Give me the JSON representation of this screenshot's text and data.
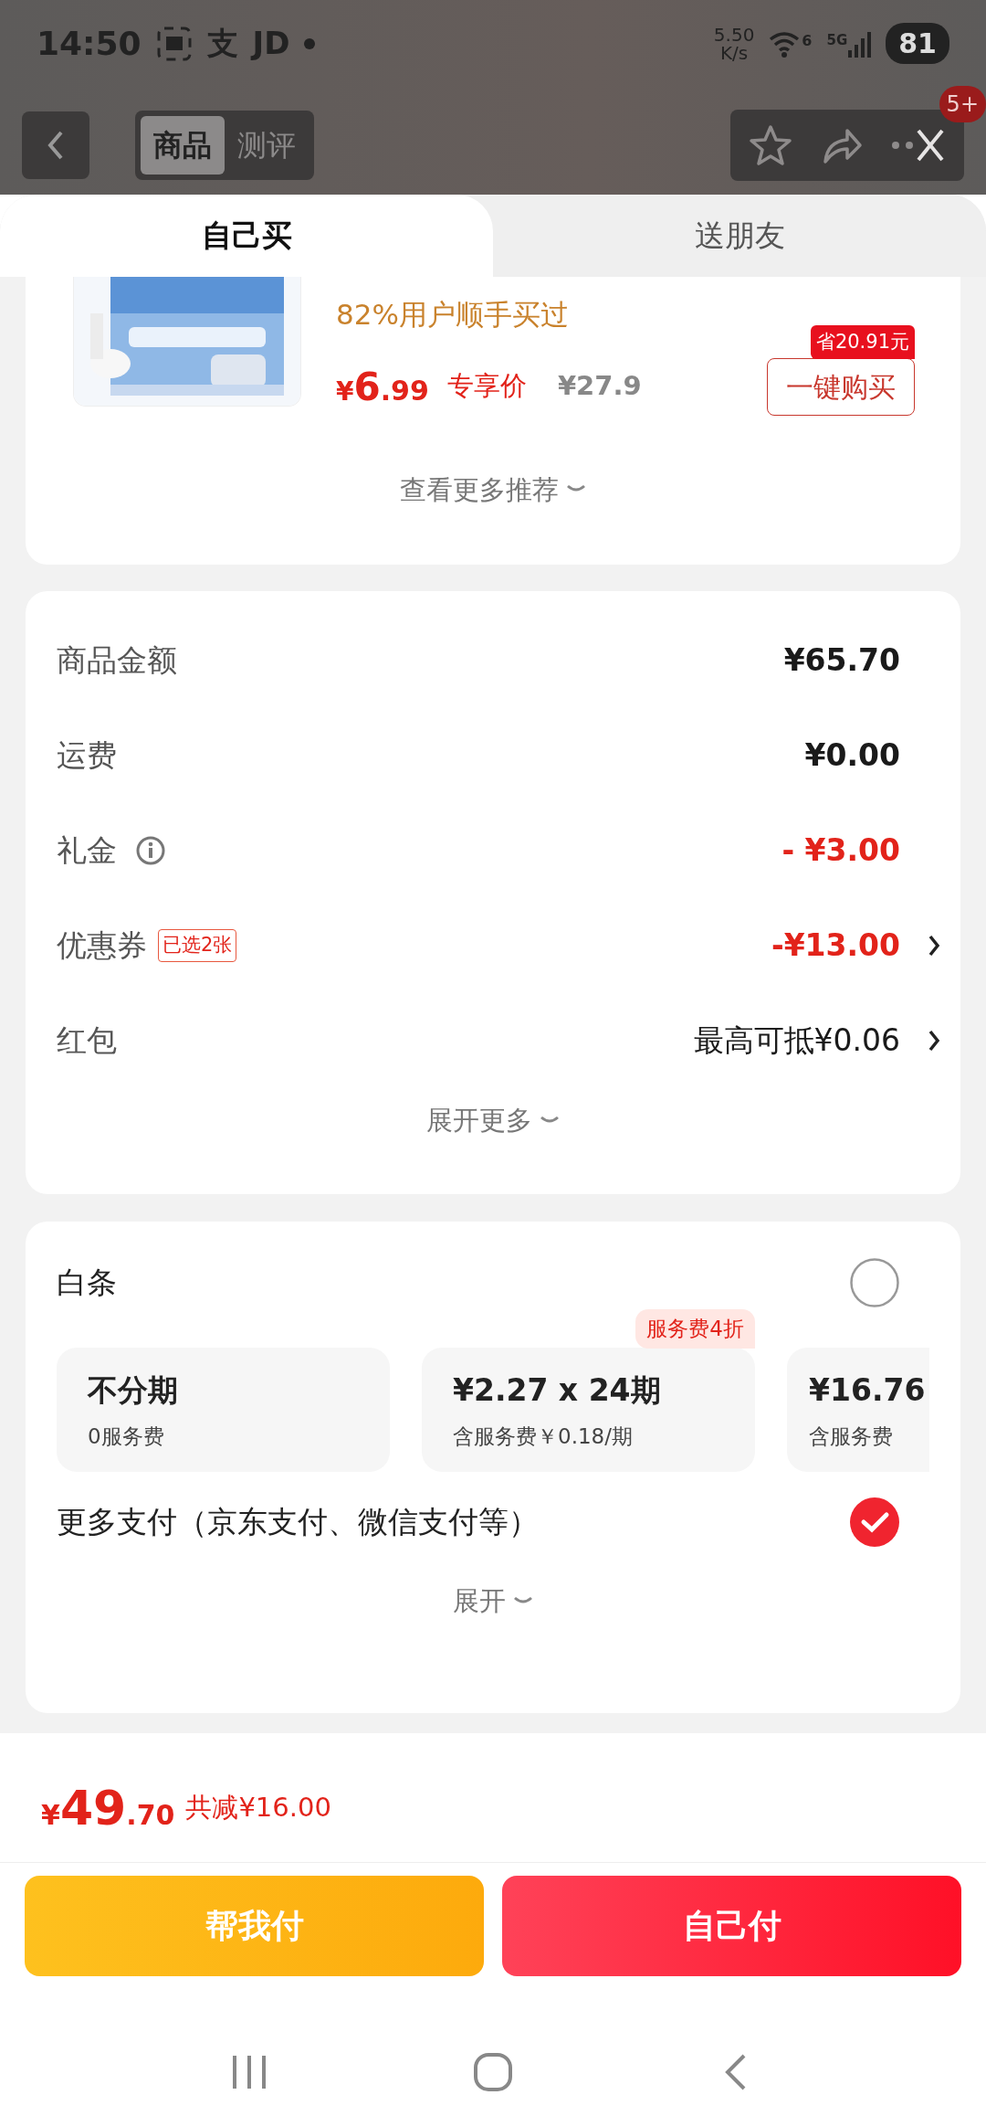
{
  "status_bar": {
    "time": "14:50",
    "notifications": [
      "支",
      "JD"
    ],
    "speed": "5.50",
    "speed_unit": "K/s",
    "wifi_label": "6",
    "network": "5G",
    "battery": "81"
  },
  "header": {
    "tabs": [
      {
        "label": "商品",
        "selected": true
      },
      {
        "label": "测评",
        "selected": false
      }
    ],
    "badge": "5+"
  },
  "sheet_tabs": [
    {
      "label": "自己买",
      "selected": true
    },
    {
      "label": "送朋友",
      "selected": false
    }
  ],
  "recommendation": {
    "social_proof": "82%用户顺手买过",
    "price": {
      "currency": "¥",
      "integer": "6",
      "decimal": ".99"
    },
    "price_tag": "专享价",
    "original_price": "¥27.9",
    "save_badge": "省20.91元",
    "buy_button": "一键购买",
    "more": "查看更多推荐"
  },
  "summary": {
    "rows": [
      {
        "label": "商品金额",
        "value": "¥65.70",
        "discount": false,
        "info": false,
        "arrow": false
      },
      {
        "label": "运费",
        "value": "¥0.00",
        "discount": false,
        "info": false,
        "arrow": false
      },
      {
        "label": "礼金",
        "value": "- ¥3.00",
        "discount": true,
        "info": true,
        "arrow": false
      },
      {
        "label": "优惠券",
        "tag": "已选2张",
        "value": "-¥13.00",
        "discount": true,
        "info": false,
        "arrow": true
      },
      {
        "label": "红包",
        "value": "最高可抵¥0.06",
        "discount": false,
        "info": false,
        "arrow": true
      }
    ],
    "expand": "展开更多"
  },
  "payment": {
    "baitiao": {
      "label": "白条",
      "selected": false
    },
    "plans": [
      {
        "title": "不分期",
        "subtitle": "0服务费"
      },
      {
        "title": "¥2.27 x 24期",
        "subtitle": "含服务费￥0.18/期",
        "tag": "服务费4折"
      },
      {
        "title": "¥16.76",
        "subtitle": "含服务费"
      }
    ],
    "more_payment": {
      "label": "更多支付（京东支付、微信支付等）",
      "selected": true
    },
    "expand": "展开"
  },
  "footer": {
    "total": {
      "currency": "¥",
      "integer": "49",
      "decimal": ".70"
    },
    "saving": "共减¥16.00",
    "buttons": [
      {
        "label": "帮我付",
        "kind": "secondary"
      },
      {
        "label": "自己付",
        "kind": "primary"
      }
    ]
  }
}
